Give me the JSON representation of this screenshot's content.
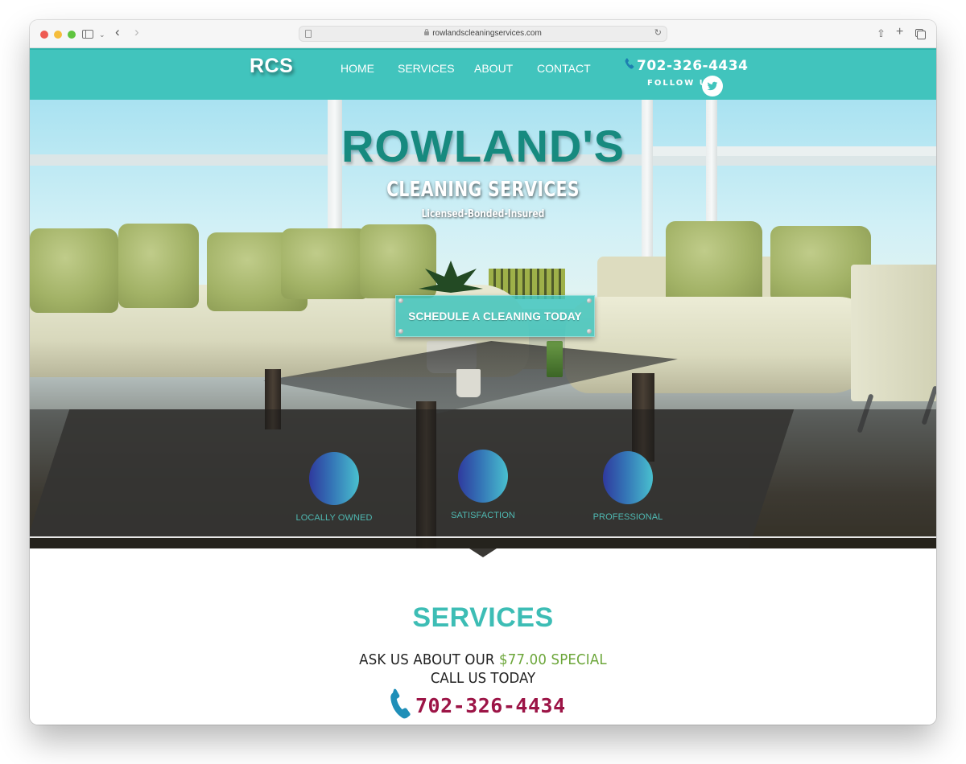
{
  "browser": {
    "url": "rowlandscleaningservices.com",
    "icons": {
      "sidebar": "sidebar-icon",
      "back": "chevron-left-icon",
      "forward": "chevron-right-icon",
      "reload": "reload-icon",
      "share": "share-icon",
      "new_tab": "plus-icon",
      "tabs": "tabs-overview-icon"
    },
    "glyphs": {
      "back": "‹",
      "forward": "›",
      "chevron_down": "⌄",
      "reload": "↻",
      "share": "⇧",
      "new_tab": "+"
    }
  },
  "header": {
    "logo": "RCS",
    "nav": [
      {
        "label": "HOME"
      },
      {
        "label": "SERVICES"
      },
      {
        "label": "ABOUT"
      },
      {
        "label": "CONTACT"
      }
    ],
    "phone": "702-326-4434",
    "follow_label": "FOLLOW US",
    "social_icon": "twitter-icon",
    "colors": {
      "bar": "#41c4bd",
      "phone_icon": "#1d7fb0"
    }
  },
  "hero": {
    "title": "ROWLAND'S",
    "subtitle": "CLEANING SERVICES",
    "tagline": "Licensed-Bonded-Insured",
    "cta_label": "SCHEDULE A CLEANING TODAY",
    "features": [
      {
        "label": "LOCALLY OWNED"
      },
      {
        "label": "SATISFACTION"
      },
      {
        "label": "PROFESSIONAL"
      }
    ],
    "colors": {
      "title": "#178a7f",
      "cta": "#41c4bd",
      "feature_label": "#4fb9b2"
    }
  },
  "services": {
    "title": "SERVICES",
    "special_prefix": "ASK US ABOUT OUR ",
    "special_price": "$77.00 SPECIAL",
    "call_line": "CALL US TODAY",
    "phone": "702-326-4434",
    "colors": {
      "title": "#3dbdb5",
      "price": "#6ca63a",
      "phone": "#9c1446",
      "phone_icon": "#1f8fb8"
    }
  }
}
